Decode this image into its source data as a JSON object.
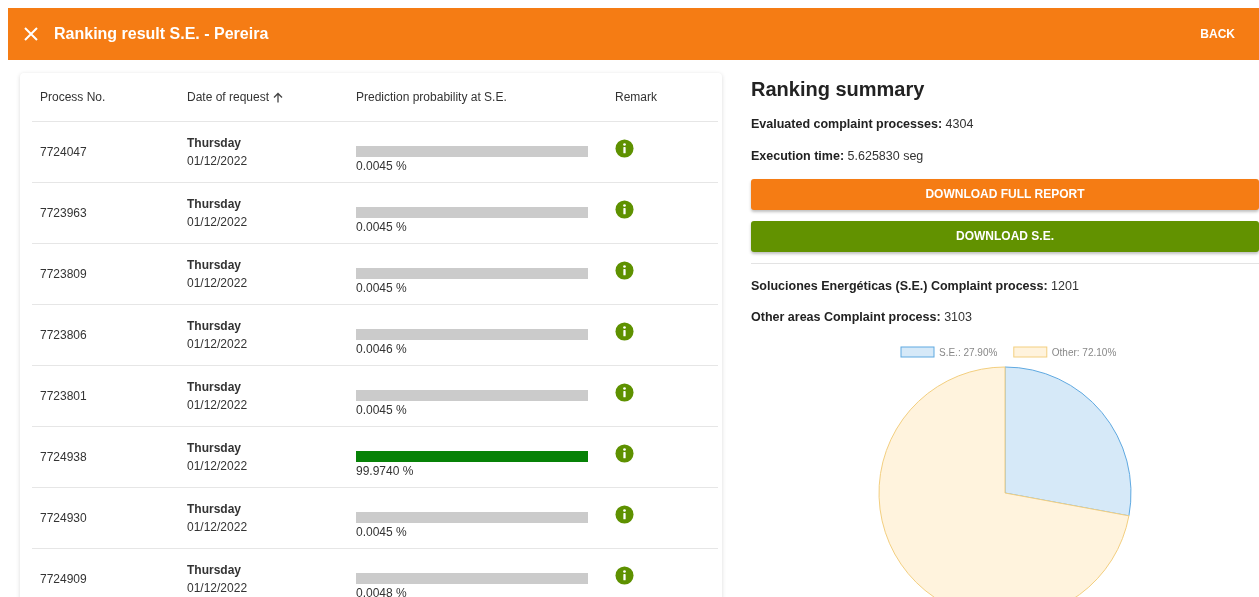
{
  "header": {
    "title": "Ranking result S.E. - Pereira",
    "back_label": "BACK"
  },
  "table": {
    "columns": [
      {
        "label": "Process No.",
        "sorted": false
      },
      {
        "label": "Date of request",
        "sorted": true
      },
      {
        "label": "Prediction probability at S.E.",
        "sorted": false
      },
      {
        "label": "Remark",
        "sorted": false
      }
    ],
    "rows": [
      {
        "process": "7724047",
        "day": "Thursday",
        "date": "01/12/2022",
        "level": 4.5e-05,
        "reading": "0.0045 %"
      },
      {
        "process": "7723963",
        "day": "Thursday",
        "date": "01/12/2022",
        "level": 4.5e-05,
        "reading": "0.0045 %"
      },
      {
        "process": "7723809",
        "day": "Thursday",
        "date": "01/12/2022",
        "level": 4.5e-05,
        "reading": "0.0045 %"
      },
      {
        "process": "7723806",
        "day": "Thursday",
        "date": "01/12/2022",
        "level": 4.6e-05,
        "reading": "0.0046 %"
      },
      {
        "process": "7723801",
        "day": "Thursday",
        "date": "01/12/2022",
        "level": 4.5e-05,
        "reading": "0.0045 %"
      },
      {
        "process": "7724938",
        "day": "Thursday",
        "date": "01/12/2022",
        "level": 0.99974,
        "reading": "99.9740 %"
      },
      {
        "process": "7724930",
        "day": "Thursday",
        "date": "01/12/2022",
        "level": 4.5e-05,
        "reading": "0.0045 %"
      },
      {
        "process": "7724909",
        "day": "Thursday",
        "date": "01/12/2022",
        "level": 4.8e-05,
        "reading": "0.0048 %"
      }
    ]
  },
  "summary": {
    "title": "Ranking summary",
    "stats": [
      {
        "label": "Evaluated complaint processes:",
        "value": "4304"
      },
      {
        "label": "Execution time:",
        "value": "5.625830 seg"
      }
    ],
    "buttons": [
      {
        "label": "DOWNLOAD FULL REPORT",
        "kind": "primary"
      },
      {
        "label": "DOWNLOAD S.E.",
        "kind": "secondary"
      }
    ],
    "areas": [
      {
        "label": "Soluciones Energéticas (S.E.) Complaint process:",
        "value": "1201"
      },
      {
        "label": "Other areas Complaint process:",
        "value": "3103"
      }
    ],
    "chart_data": {
      "type": "pie",
      "legend": "top",
      "categories": [
        "S.E.: 27.90%",
        "Other: 72.10%"
      ],
      "values": [
        27.9,
        72.1
      ],
      "colors": [
        "#d6e9f8",
        "#fff3dd"
      ]
    }
  }
}
